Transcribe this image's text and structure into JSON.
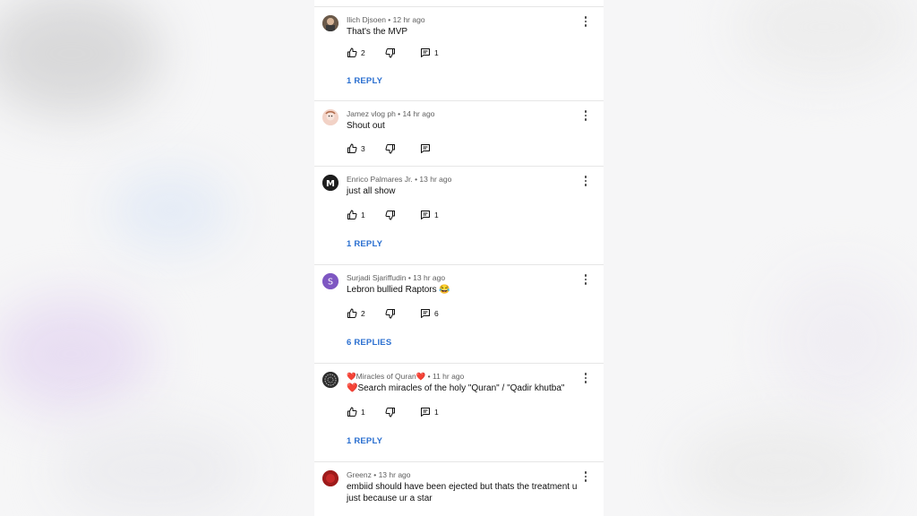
{
  "comments": [
    {
      "author": "Ilich Djsoen",
      "time": "12 hr ago",
      "text": "That's the MVP",
      "likes": "2",
      "reply_count": "1",
      "replies_label": "1 REPLY",
      "avatar_color": "#5b4a3d"
    },
    {
      "author": "Jamez vlog ph",
      "time": "14 hr ago",
      "text": "Shout out",
      "likes": "3",
      "reply_count": "",
      "replies_label": "",
      "avatar_color": "#e8b8a8"
    },
    {
      "author": "Enrico Palmares Jr.",
      "time": "13 hr ago",
      "text": "just all show",
      "likes": "1",
      "reply_count": "1",
      "replies_label": "1 REPLY",
      "avatar_color": "#222222",
      "avatar_letter": "M"
    },
    {
      "author": "Surjadi Sjariffudin",
      "time": "13 hr ago",
      "text": "Lebron bullied Raptors 😂",
      "likes": "2",
      "reply_count": "6",
      "replies_label": "6 REPLIES",
      "avatar_color": "#7e57c2",
      "avatar_letter": "S"
    },
    {
      "author_prefix": "❤️",
      "author": "Miracles of Quran",
      "author_suffix": "❤️",
      "time": "11 hr ago",
      "text_prefix": "❤️",
      "text": "Search miracles of the holy \"Quran\" / \"Qadir khutba\"",
      "likes": "1",
      "reply_count": "1",
      "replies_label": "1 REPLY",
      "avatar_color": "#3a3a3a"
    },
    {
      "author": "Greenz",
      "time": "13 hr ago",
      "text": "embiid should have been ejected but thats the treatment u just because ur a star",
      "avatar_color": "#a31c1c"
    }
  ],
  "separator": " • ",
  "colors": {
    "reply_link": "#2a6fd0",
    "meta_text": "#606060",
    "body_text": "#0f0f0f"
  }
}
